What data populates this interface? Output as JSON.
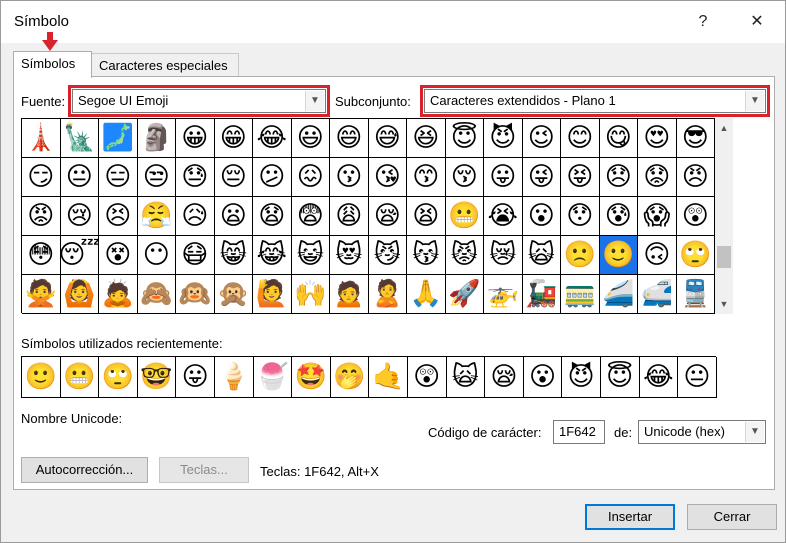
{
  "title": "Símbolo",
  "title_buttons": {
    "help": "?",
    "close": "✕"
  },
  "tabs": [
    {
      "label": "Símbolos",
      "active": true
    },
    {
      "label": "Caracteres especiales",
      "active": false
    }
  ],
  "fuente": {
    "label": "Fuente:",
    "value": "Segoe UI Emoji"
  },
  "subconjunto": {
    "label": "Subconjunto:",
    "value": "Caracteres extendidos - Plano 1"
  },
  "highlight_color": "#d9232b",
  "selection_color": "#1a73e8",
  "grid": [
    [
      "🗼",
      "🗽",
      "🗾",
      "🗿",
      "😀",
      "😁",
      "😂",
      "😃",
      "😄",
      "😅",
      "😆",
      "😇",
      "😈",
      "😉",
      "😊",
      "😋",
      "😍",
      "😎"
    ],
    [
      "😏",
      "😐",
      "😑",
      "😒",
      "😓",
      "😔",
      "😕",
      "😖",
      "😗",
      "😘",
      "😙",
      "😚",
      "😛",
      "😜",
      "😝",
      "😞",
      "😟",
      "😠"
    ],
    [
      "😡",
      "😢",
      "😣",
      "😤",
      "😥",
      "😦",
      "😧",
      "😨",
      "😩",
      "😪",
      "😫",
      "😬",
      "😭",
      "😮",
      "😯",
      "😰",
      "😱",
      "😲"
    ],
    [
      "😳",
      "😴",
      "😵",
      "😶",
      "😷",
      "😸",
      "😹",
      "😺",
      "😻",
      "😼",
      "😽",
      "😾",
      "😿",
      "🙀",
      "🙁",
      "🙂",
      "🙃",
      "🙄"
    ],
    [
      "🙅",
      "🙆",
      "🙇",
      "🙈",
      "🙉",
      "🙊",
      "🙋",
      "🙌",
      "🙍",
      "🙎",
      "🙏",
      "🚀",
      "🚁",
      "🚂",
      "🚃",
      "🚄",
      "🚅",
      "🚆"
    ]
  ],
  "selected": {
    "row": 3,
    "col": 15
  },
  "recent": {
    "label": "Símbolos utilizados recientemente:",
    "symbols": [
      "🙂",
      "😬",
      "🙄",
      "🤓",
      "😛",
      "🍦",
      "🍧",
      "🤩",
      "🤭",
      "🤙",
      "😲",
      "🙀",
      "😪",
      "😮",
      "😈",
      "😇",
      "😂",
      "😐",
      "🤨"
    ]
  },
  "unicode_name": {
    "label": "Nombre Unicode:"
  },
  "codigo": {
    "label": "Código de carácter:",
    "value": "1F642"
  },
  "de": {
    "label": "de:",
    "value": "Unicode (hex)"
  },
  "buttons": {
    "autocorreccion": "Autocorrección...",
    "teclas": "Teclas...",
    "teclas_text": "Teclas: 1F642, Alt+X",
    "insertar": "Insertar",
    "cerrar": "Cerrar"
  }
}
